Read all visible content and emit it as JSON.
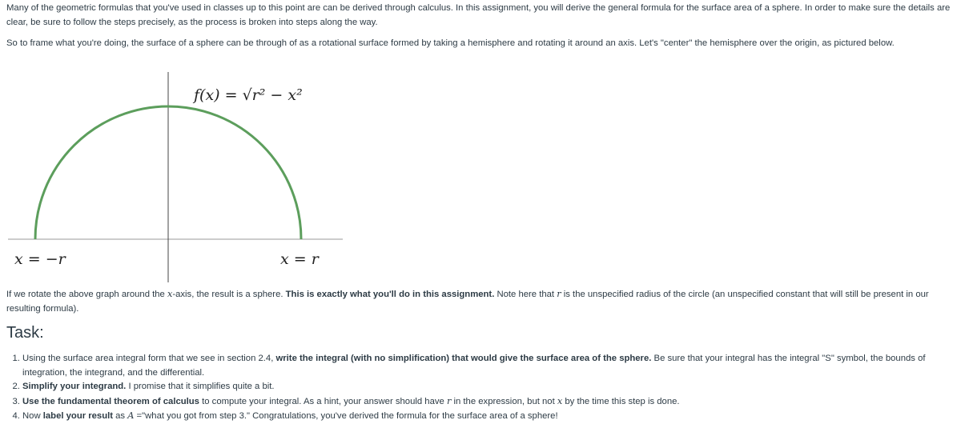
{
  "intro": "Many of the geometric formulas that you've used in classes up to this point are can be derived through calculus. In this assignment, you will derive the general formula for the surface area of a sphere. In order to make sure the details are clear, be sure to follow the steps precisely, as the process is broken into steps along the way.",
  "frame": "So to frame what you're doing, the surface of a sphere can be through of as a rotational surface formed by taking a hemisphere and rotating it around an axis. Let's \"center\" the hemisphere over the origin, as pictured below.",
  "figure": {
    "function_label": "f(x) = √r² − x²",
    "left_label": "x = −r",
    "right_label": "x = r",
    "curve_color": "#5c9e5c"
  },
  "rotate": {
    "a": "If we rotate the above graph around the ",
    "x": "x",
    "b": "-axis, the result is a sphere. ",
    "bold": "This is exactly what you'll do in this assignment.",
    "c": " Note here that ",
    "r": "r",
    "d": " is the unspecified radius of the circle (an unspecified constant that will still be present in our resulting formula)."
  },
  "task_heading": "Task:",
  "steps": [
    {
      "a": "Using the surface area integral form that we see in section 2.4, ",
      "bold": "write the integral (with no simplification) that would give the surface area of the sphere.",
      "b": " Be sure that your integral has the integral \"S\" symbol, the bounds of integration, the integrand, and the differential."
    },
    {
      "bold": "Simplify your integrand.",
      "b": " I promise that it simplifies quite a bit."
    },
    {
      "bold": "Use the fundamental theorem of calculus",
      "b": " to compute your integral. As a hint, your answer should have ",
      "r": "r",
      "c": " in the expression, but not ",
      "x": "x",
      "d": " by the time this step is done."
    },
    {
      "a": "Now ",
      "bold": "label your result",
      "b": " as ",
      "A": "A",
      "c": " =\"what you got from step 3.\" Congratulations, you've derived the formula for the surface area of a sphere!"
    }
  ]
}
